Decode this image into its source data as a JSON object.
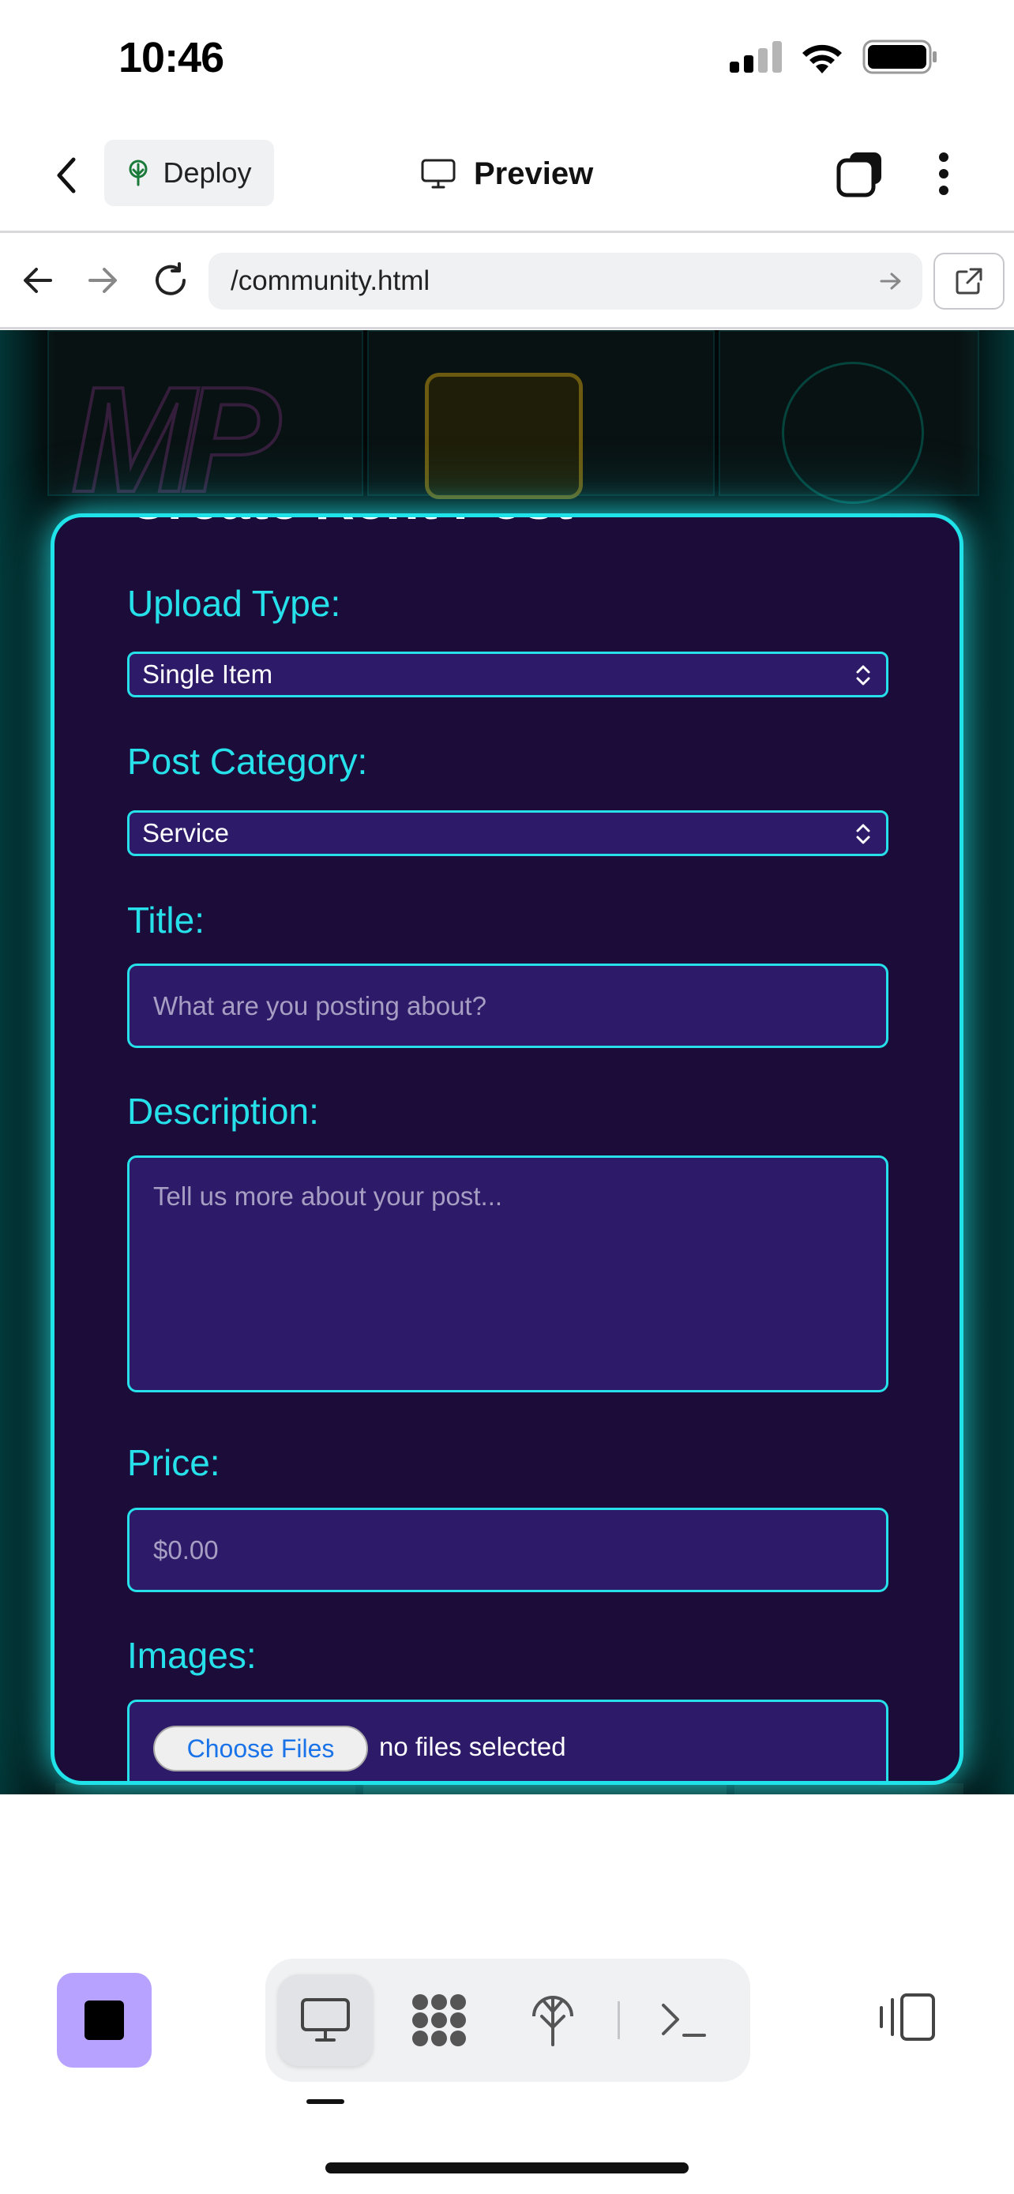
{
  "status_bar": {
    "time": "10:46"
  },
  "header": {
    "deploy_label": "Deploy",
    "preview_label": "Preview"
  },
  "url_bar": {
    "url": "/community.html"
  },
  "form": {
    "heading": "Create Rent Post",
    "upload_type": {
      "label": "Upload Type:",
      "value": "Single Item"
    },
    "post_category": {
      "label": "Post Category:",
      "value": "Service"
    },
    "title": {
      "label": "Title:",
      "placeholder": "What are you posting about?"
    },
    "description": {
      "label": "Description:",
      "placeholder": "Tell us more about your post..."
    },
    "price": {
      "label": "Price:",
      "placeholder": "$0.00"
    },
    "images": {
      "label": "Images:",
      "button": "Choose Files",
      "status": "no files selected"
    }
  },
  "colors": {
    "accent_cyan": "#26e0ea",
    "modal_bg": "#1b0c3a",
    "input_bg": "#2d1a68",
    "stop_button": "#b7a2ff"
  },
  "icons": {
    "header": [
      "back-arrow-icon",
      "deploy-tree-icon",
      "monitor-icon",
      "tabs-icon",
      "more-vertical-icon"
    ],
    "url_bar": [
      "back-icon",
      "forward-icon",
      "reload-icon",
      "go-arrow-icon",
      "open-external-icon"
    ],
    "toolbar": [
      "stop-icon",
      "monitor-icon",
      "apps-grid-icon",
      "deploy-tree-icon",
      "terminal-icon",
      "side-panel-icon"
    ]
  }
}
